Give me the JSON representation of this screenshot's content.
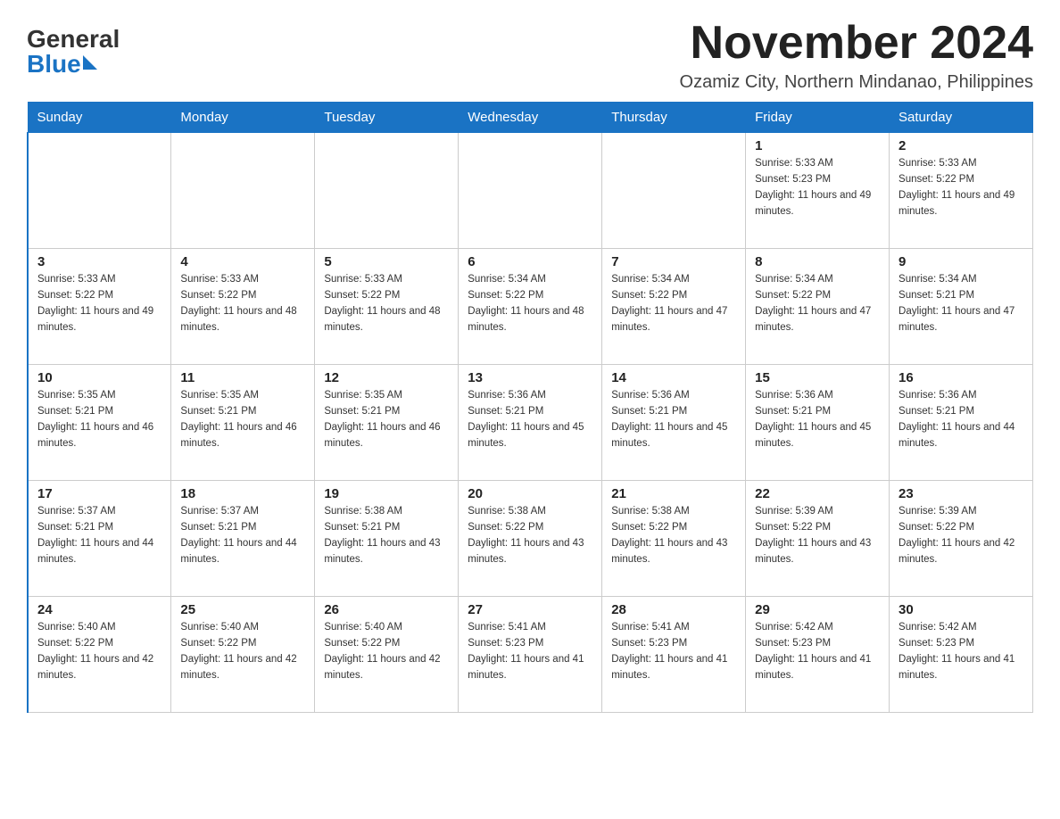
{
  "header": {
    "logo_general": "General",
    "logo_blue": "Blue",
    "month_title": "November 2024",
    "location": "Ozamiz City, Northern Mindanao, Philippines"
  },
  "weekdays": [
    "Sunday",
    "Monday",
    "Tuesday",
    "Wednesday",
    "Thursday",
    "Friday",
    "Saturday"
  ],
  "weeks": [
    [
      {
        "day": "",
        "sunrise": "",
        "sunset": "",
        "daylight": ""
      },
      {
        "day": "",
        "sunrise": "",
        "sunset": "",
        "daylight": ""
      },
      {
        "day": "",
        "sunrise": "",
        "sunset": "",
        "daylight": ""
      },
      {
        "day": "",
        "sunrise": "",
        "sunset": "",
        "daylight": ""
      },
      {
        "day": "",
        "sunrise": "",
        "sunset": "",
        "daylight": ""
      },
      {
        "day": "1",
        "sunrise": "Sunrise: 5:33 AM",
        "sunset": "Sunset: 5:23 PM",
        "daylight": "Daylight: 11 hours and 49 minutes."
      },
      {
        "day": "2",
        "sunrise": "Sunrise: 5:33 AM",
        "sunset": "Sunset: 5:22 PM",
        "daylight": "Daylight: 11 hours and 49 minutes."
      }
    ],
    [
      {
        "day": "3",
        "sunrise": "Sunrise: 5:33 AM",
        "sunset": "Sunset: 5:22 PM",
        "daylight": "Daylight: 11 hours and 49 minutes."
      },
      {
        "day": "4",
        "sunrise": "Sunrise: 5:33 AM",
        "sunset": "Sunset: 5:22 PM",
        "daylight": "Daylight: 11 hours and 48 minutes."
      },
      {
        "day": "5",
        "sunrise": "Sunrise: 5:33 AM",
        "sunset": "Sunset: 5:22 PM",
        "daylight": "Daylight: 11 hours and 48 minutes."
      },
      {
        "day": "6",
        "sunrise": "Sunrise: 5:34 AM",
        "sunset": "Sunset: 5:22 PM",
        "daylight": "Daylight: 11 hours and 48 minutes."
      },
      {
        "day": "7",
        "sunrise": "Sunrise: 5:34 AM",
        "sunset": "Sunset: 5:22 PM",
        "daylight": "Daylight: 11 hours and 47 minutes."
      },
      {
        "day": "8",
        "sunrise": "Sunrise: 5:34 AM",
        "sunset": "Sunset: 5:22 PM",
        "daylight": "Daylight: 11 hours and 47 minutes."
      },
      {
        "day": "9",
        "sunrise": "Sunrise: 5:34 AM",
        "sunset": "Sunset: 5:21 PM",
        "daylight": "Daylight: 11 hours and 47 minutes."
      }
    ],
    [
      {
        "day": "10",
        "sunrise": "Sunrise: 5:35 AM",
        "sunset": "Sunset: 5:21 PM",
        "daylight": "Daylight: 11 hours and 46 minutes."
      },
      {
        "day": "11",
        "sunrise": "Sunrise: 5:35 AM",
        "sunset": "Sunset: 5:21 PM",
        "daylight": "Daylight: 11 hours and 46 minutes."
      },
      {
        "day": "12",
        "sunrise": "Sunrise: 5:35 AM",
        "sunset": "Sunset: 5:21 PM",
        "daylight": "Daylight: 11 hours and 46 minutes."
      },
      {
        "day": "13",
        "sunrise": "Sunrise: 5:36 AM",
        "sunset": "Sunset: 5:21 PM",
        "daylight": "Daylight: 11 hours and 45 minutes."
      },
      {
        "day": "14",
        "sunrise": "Sunrise: 5:36 AM",
        "sunset": "Sunset: 5:21 PM",
        "daylight": "Daylight: 11 hours and 45 minutes."
      },
      {
        "day": "15",
        "sunrise": "Sunrise: 5:36 AM",
        "sunset": "Sunset: 5:21 PM",
        "daylight": "Daylight: 11 hours and 45 minutes."
      },
      {
        "day": "16",
        "sunrise": "Sunrise: 5:36 AM",
        "sunset": "Sunset: 5:21 PM",
        "daylight": "Daylight: 11 hours and 44 minutes."
      }
    ],
    [
      {
        "day": "17",
        "sunrise": "Sunrise: 5:37 AM",
        "sunset": "Sunset: 5:21 PM",
        "daylight": "Daylight: 11 hours and 44 minutes."
      },
      {
        "day": "18",
        "sunrise": "Sunrise: 5:37 AM",
        "sunset": "Sunset: 5:21 PM",
        "daylight": "Daylight: 11 hours and 44 minutes."
      },
      {
        "day": "19",
        "sunrise": "Sunrise: 5:38 AM",
        "sunset": "Sunset: 5:21 PM",
        "daylight": "Daylight: 11 hours and 43 minutes."
      },
      {
        "day": "20",
        "sunrise": "Sunrise: 5:38 AM",
        "sunset": "Sunset: 5:22 PM",
        "daylight": "Daylight: 11 hours and 43 minutes."
      },
      {
        "day": "21",
        "sunrise": "Sunrise: 5:38 AM",
        "sunset": "Sunset: 5:22 PM",
        "daylight": "Daylight: 11 hours and 43 minutes."
      },
      {
        "day": "22",
        "sunrise": "Sunrise: 5:39 AM",
        "sunset": "Sunset: 5:22 PM",
        "daylight": "Daylight: 11 hours and 43 minutes."
      },
      {
        "day": "23",
        "sunrise": "Sunrise: 5:39 AM",
        "sunset": "Sunset: 5:22 PM",
        "daylight": "Daylight: 11 hours and 42 minutes."
      }
    ],
    [
      {
        "day": "24",
        "sunrise": "Sunrise: 5:40 AM",
        "sunset": "Sunset: 5:22 PM",
        "daylight": "Daylight: 11 hours and 42 minutes."
      },
      {
        "day": "25",
        "sunrise": "Sunrise: 5:40 AM",
        "sunset": "Sunset: 5:22 PM",
        "daylight": "Daylight: 11 hours and 42 minutes."
      },
      {
        "day": "26",
        "sunrise": "Sunrise: 5:40 AM",
        "sunset": "Sunset: 5:22 PM",
        "daylight": "Daylight: 11 hours and 42 minutes."
      },
      {
        "day": "27",
        "sunrise": "Sunrise: 5:41 AM",
        "sunset": "Sunset: 5:23 PM",
        "daylight": "Daylight: 11 hours and 41 minutes."
      },
      {
        "day": "28",
        "sunrise": "Sunrise: 5:41 AM",
        "sunset": "Sunset: 5:23 PM",
        "daylight": "Daylight: 11 hours and 41 minutes."
      },
      {
        "day": "29",
        "sunrise": "Sunrise: 5:42 AM",
        "sunset": "Sunset: 5:23 PM",
        "daylight": "Daylight: 11 hours and 41 minutes."
      },
      {
        "day": "30",
        "sunrise": "Sunrise: 5:42 AM",
        "sunset": "Sunset: 5:23 PM",
        "daylight": "Daylight: 11 hours and 41 minutes."
      }
    ]
  ]
}
